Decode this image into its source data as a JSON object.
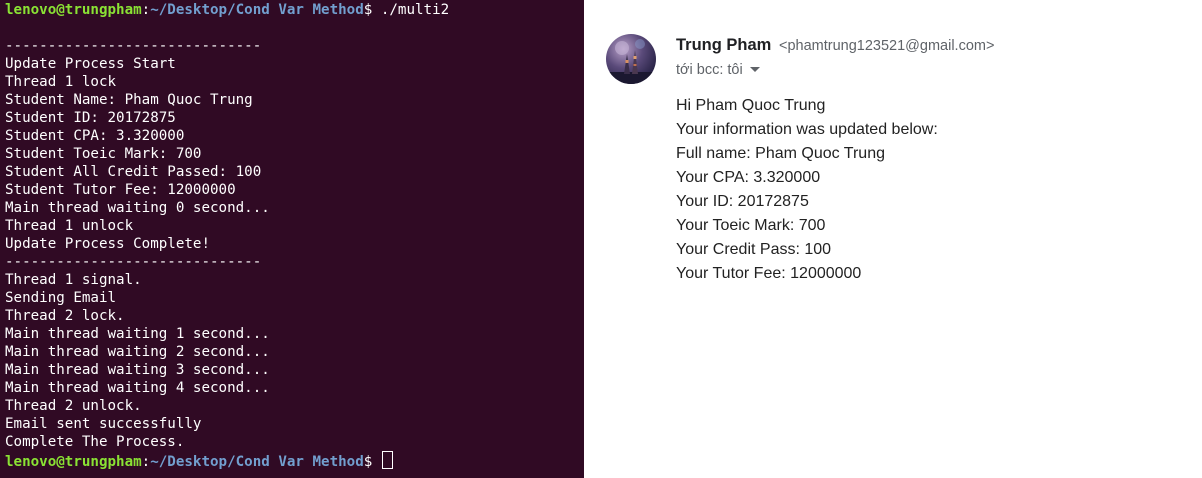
{
  "terminal": {
    "prompt": {
      "user_host": "lenovo@trungpham",
      "separator": ":",
      "path": "~/Desktop/Cond Var Method",
      "dollar": "$",
      "command": " ./multi2"
    },
    "output": [
      "",
      "------------------------------",
      "Update Process Start",
      "Thread 1 lock",
      "Student Name: Pham Quoc Trung",
      "Student ID: 20172875",
      "Student CPA: 3.320000",
      "Student Toeic Mark: 700",
      "Student All Credit Passed: 100",
      "Student Tutor Fee: 12000000",
      "Main thread waiting 0 second...",
      "Thread 1 unlock",
      "Update Process Complete!",
      "------------------------------",
      "Thread 1 signal.",
      "Sending Email",
      "Thread 2 lock.",
      "Main thread waiting 1 second...",
      "Main thread waiting 2 second...",
      "Main thread waiting 3 second...",
      "Main thread waiting 4 second...",
      "Thread 2 unlock.",
      "Email sent successfully",
      "Complete The Process."
    ],
    "final_prompt": {
      "user_host": "lenovo@trungpham",
      "separator": ":",
      "path": "~/Desktop/Cond Var Method",
      "dollar": "$ "
    },
    "colors": {
      "background": "#300a24",
      "user_host": "#8ae234",
      "path": "#729fcf",
      "text": "#ffffff"
    }
  },
  "email": {
    "sender_name": "Trung Pham",
    "sender_email": "<phamtrung123521@gmail.com>",
    "recipient_text": "tới bcc: tôi",
    "avatar_icon": "sender-avatar",
    "body": [
      "Hi Pham Quoc Trung",
      "Your information was updated below:",
      "Full name: Pham Quoc Trung",
      "Your CPA: 3.320000",
      "Your ID: 20172875",
      "Your Toeic Mark: 700",
      "Your Credit Pass: 100",
      "Your Tutor Fee: 12000000"
    ]
  }
}
